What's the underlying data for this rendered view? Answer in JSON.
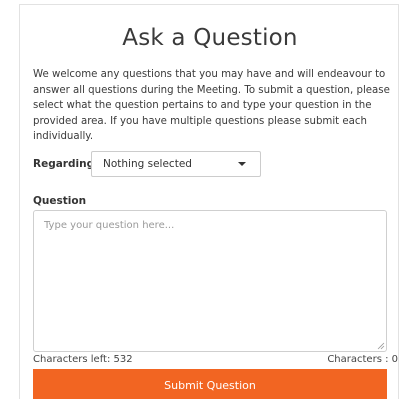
{
  "form": {
    "title": "Ask a Question",
    "intro": "We welcome any questions that you may have and will endeavour to answer all questions during the Meeting. To submit a question, please select what the question pertains to and type your question in the provided area. If you have multiple questions please submit each individually.",
    "regarding_label": "Regarding",
    "regarding_value": "Nothing selected",
    "question_label": "Question",
    "question_placeholder": "Type your question here...",
    "question_value": "",
    "characters_left": "Characters left: 532",
    "characters_count": "Characters : 0",
    "submit_label": "Submit Question"
  },
  "colors": {
    "accent": "#f26522",
    "text": "#333333",
    "placeholder": "#9a9a9a",
    "border": "#cccccc"
  },
  "icons": {
    "select_caret": "chevron-down-icon",
    "textarea_resize": "resize-grip-icon"
  }
}
